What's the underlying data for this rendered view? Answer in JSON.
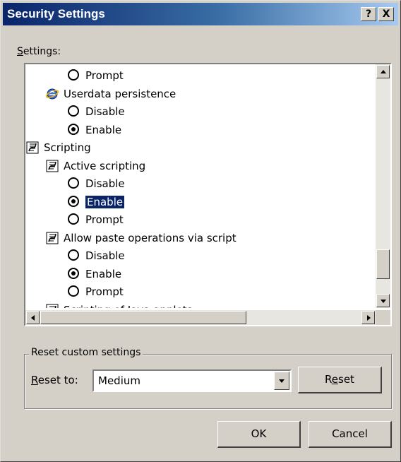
{
  "window": {
    "title": "Security Settings",
    "help_label": "?",
    "close_label": "X"
  },
  "settings": {
    "label_accel": "S",
    "label_rest": "ettings:",
    "rows": [
      {
        "kind": "radio",
        "checked": false,
        "label": "Prompt"
      },
      {
        "kind": "ie-icon",
        "label": "Userdata persistence"
      },
      {
        "kind": "radio",
        "checked": false,
        "label": "Disable"
      },
      {
        "kind": "radio",
        "checked": true,
        "label": "Enable"
      },
      {
        "kind": "script-icon",
        "label": "Scripting"
      },
      {
        "kind": "script-icon",
        "label": "Active scripting"
      },
      {
        "kind": "radio",
        "checked": false,
        "label": "Disable"
      },
      {
        "kind": "radio",
        "checked": true,
        "label": "Enable",
        "selected": true
      },
      {
        "kind": "radio",
        "checked": false,
        "label": "Prompt"
      },
      {
        "kind": "script-icon",
        "label": "Allow paste operations via script"
      },
      {
        "kind": "radio",
        "checked": false,
        "label": "Disable"
      },
      {
        "kind": "radio",
        "checked": true,
        "label": "Enable"
      },
      {
        "kind": "radio",
        "checked": false,
        "label": "Prompt"
      },
      {
        "kind": "script-icon",
        "label": "Scripting of Java applets"
      }
    ]
  },
  "reset_group": {
    "legend": "Reset custom settings",
    "reset_to_accel": "R",
    "reset_to_rest": "eset to:",
    "selected_level": "Medium",
    "reset_btn_pre": "R",
    "reset_btn_accel": "e",
    "reset_btn_post": "set"
  },
  "footer": {
    "ok_label": "OK",
    "cancel_label": "Cancel"
  },
  "colors": {
    "face": "#d4d0c8",
    "title_start": "#0a246a",
    "title_end": "#a6caf0",
    "selection": "#0a246a"
  }
}
